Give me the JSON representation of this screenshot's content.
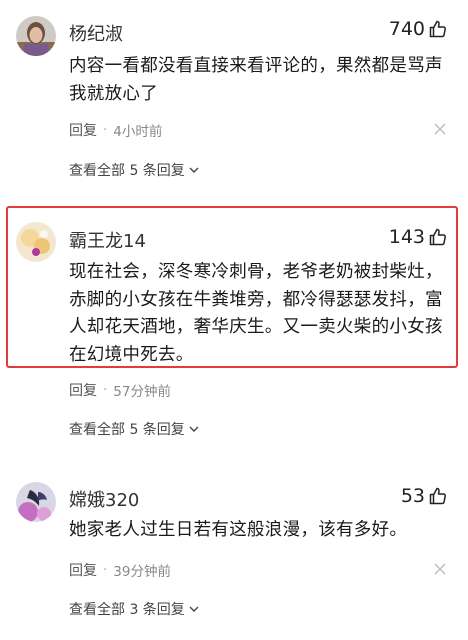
{
  "comments": [
    {
      "username": "杨纪淑",
      "likes": "740",
      "text_lines": [
        "内容一看都没看直接来看评论的，果然都是骂声",
        "我就放心了"
      ],
      "reply_label": "回复",
      "dot": "·",
      "time": "4小时前",
      "view_all": "查看全部 5 条回复"
    },
    {
      "username": "霸王龙14",
      "likes": "143",
      "text_lines": [
        "现在社会，深冬寒冷刺骨，老爷老奶被封柴灶，",
        "赤脚的小女孩在牛粪堆旁，都冷得瑟瑟发抖，富",
        "人却花天酒地，奢华庆生。又一卖火柴的小女孩",
        "在幻境中死去。"
      ],
      "reply_label": "回复",
      "dot": "·",
      "time": "57分钟前",
      "view_all": "查看全部 5 条回复"
    },
    {
      "username": "嫦娥320",
      "likes": "53",
      "text_lines": [
        "她家老人过生日若有这般浪漫，该有多好。"
      ],
      "reply_label": "回复",
      "dot": "·",
      "time": "39分钟前",
      "view_all": "查看全部 3 条回复"
    }
  ],
  "colors": {
    "highlight": "#e23b3b",
    "meta": "#888888"
  }
}
